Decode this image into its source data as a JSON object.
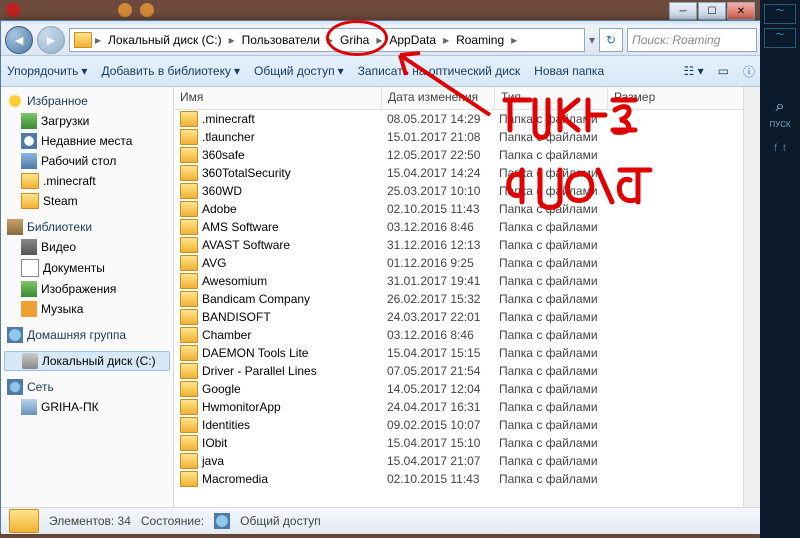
{
  "breadcrumbs": [
    "Локальный диск (C:)",
    "Пользователи",
    "Griha",
    "AppData",
    "Roaming"
  ],
  "search_placeholder": "Поиск: Roaming",
  "toolbar": {
    "organize": "Упорядочить",
    "add_lib": "Добавить в библиотеку",
    "share": "Общий доступ",
    "burn": "Записать на оптический диск",
    "new_folder": "Новая папка"
  },
  "columns": {
    "name": "Имя",
    "date": "Дата изменения",
    "type": "Тип",
    "size": "Размер"
  },
  "sidebar": {
    "fav": {
      "head": "Избранное",
      "items": [
        "Загрузки",
        "Недавние места",
        "Рабочий стол",
        ".minecraft",
        "Steam"
      ]
    },
    "lib": {
      "head": "Библиотеки",
      "items": [
        "Видео",
        "Документы",
        "Изображения",
        "Музыка"
      ]
    },
    "home": {
      "head": "Домашняя группа"
    },
    "drive": {
      "head": "Локальный диск (C:)"
    },
    "net": {
      "head": "Сеть",
      "items": [
        "GRIHA-ПК"
      ]
    }
  },
  "files": [
    {
      "name": ".minecraft",
      "date": "08.05.2017 14:29",
      "type": "Папка с файлами"
    },
    {
      "name": ".tlauncher",
      "date": "15.01.2017 21:08",
      "type": "Папка с файлами"
    },
    {
      "name": "360safe",
      "date": "12.05.2017 22:50",
      "type": "Папка с файлами"
    },
    {
      "name": "360TotalSecurity",
      "date": "15.04.2017 14:24",
      "type": "Папка с файлами"
    },
    {
      "name": "360WD",
      "date": "25.03.2017 10:10",
      "type": "Папка с файлами"
    },
    {
      "name": "Adobe",
      "date": "02.10.2015 11:43",
      "type": "Папка с файлами"
    },
    {
      "name": "AMS Software",
      "date": "03.12.2016 8:46",
      "type": "Папка с файлами"
    },
    {
      "name": "AVAST Software",
      "date": "31.12.2016 12:13",
      "type": "Папка с файлами"
    },
    {
      "name": "AVG",
      "date": "01.12.2016 9:25",
      "type": "Папка с файлами"
    },
    {
      "name": "Awesomium",
      "date": "31.01.2017 19:41",
      "type": "Папка с файлами"
    },
    {
      "name": "Bandicam Company",
      "date": "26.02.2017 15:32",
      "type": "Папка с файлами"
    },
    {
      "name": "BANDISOFT",
      "date": "24.03.2017 22:01",
      "type": "Папка с файлами"
    },
    {
      "name": "Chamber",
      "date": "03.12.2016 8:46",
      "type": "Папка с файлами"
    },
    {
      "name": "DAEMON Tools Lite",
      "date": "15.04.2017 15:15",
      "type": "Папка с файлами"
    },
    {
      "name": "Driver - Parallel Lines",
      "date": "07.05.2017 21:54",
      "type": "Папка с файлами"
    },
    {
      "name": "Google",
      "date": "14.05.2017 12:04",
      "type": "Папка с файлами"
    },
    {
      "name": "HwmonitorApp",
      "date": "24.04.2017 16:31",
      "type": "Папка с файлами"
    },
    {
      "name": "Identities",
      "date": "09.02.2015 10:07",
      "type": "Папка с файлами"
    },
    {
      "name": "IObit",
      "date": "15.04.2017 15:10",
      "type": "Папка с файлами"
    },
    {
      "name": "java",
      "date": "15.04.2017 21:07",
      "type": "Папка с файлами"
    },
    {
      "name": "Macromedia",
      "date": "02.10.2015 11:43",
      "type": "Папка с файлами"
    }
  ],
  "status": {
    "count_label": "Элементов: 34",
    "state_label": "Состояние:",
    "share_label": "Общий доступ"
  },
  "rightpanel": {
    "search_label": "ПУСК"
  },
  "annotation_text": "тыкнесюда"
}
